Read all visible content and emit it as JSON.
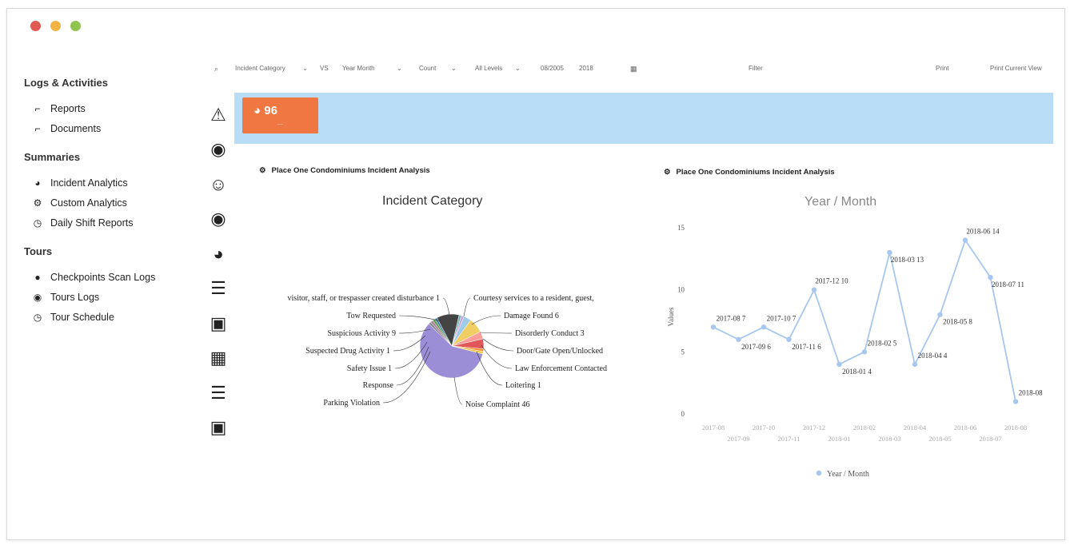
{
  "window": {
    "traffic_colors": [
      "#e05a52",
      "#f2b544",
      "#8fc44f"
    ]
  },
  "sidebar": {
    "sections": [
      {
        "title": "Logs & Activities",
        "items": [
          {
            "label": "Reports",
            "icon": "file-icon"
          },
          {
            "label": "Documents",
            "icon": "file-icon"
          }
        ]
      },
      {
        "title": "Summaries",
        "items": [
          {
            "label": "Incident Analytics",
            "icon": "pie-icon"
          },
          {
            "label": "Custom Analytics",
            "icon": "cogs-icon"
          },
          {
            "label": "Daily Shift Reports",
            "icon": "clock-icon"
          }
        ]
      },
      {
        "title": "Tours",
        "items": [
          {
            "label": "Checkpoints Scan Logs",
            "icon": "circle-icon"
          },
          {
            "label": "Tours Logs",
            "icon": "globe-icon"
          },
          {
            "label": "Tour Schedule",
            "icon": "clock-icon"
          }
        ]
      }
    ]
  },
  "toolbar": {
    "row_field": "Incident Category",
    "vs": "VS",
    "col_field": "Year Month",
    "aggregate": "Count",
    "levels": "All Levels",
    "date_from": "08/2005",
    "date_to": "2018",
    "filter": "Filter",
    "print": "Print",
    "print_view": "Print Current View"
  },
  "banner": {
    "kpi_value": "96"
  },
  "panels": {
    "left": {
      "header": "Place One Condominiums Incident Analysis",
      "chart_title": "Incident Category"
    },
    "right": {
      "header": "Place One Condominiums Incident Analysis",
      "chart_title": "Year / Month"
    }
  },
  "chart_data": [
    {
      "type": "pie",
      "title": "Incident Category",
      "slices": [
        {
          "label": "Noise Complaint",
          "value": 46,
          "color": "#9b8ed6"
        },
        {
          "label": "Parking Violation",
          "value": 1,
          "color": "#8a8a8a"
        },
        {
          "label": "Response",
          "value": 1,
          "color": "#b07aa1"
        },
        {
          "label": "Safety Issue",
          "value": 1,
          "color": "#59a14f"
        },
        {
          "label": "Suspected Drug Activity",
          "value": 1,
          "color": "#4e79a7"
        },
        {
          "label": "Suspicious Activity",
          "value": 9,
          "color": "#444444"
        },
        {
          "label": "Tow Requested",
          "value": 1,
          "color": "#76b7b2"
        },
        {
          "label": "visitor, staff, or trespasser created disturbance",
          "value": 1,
          "color": "#c9a0dc"
        },
        {
          "label": "Courtesy services to a resident, guest,",
          "value": 3,
          "color": "#a0cbe8"
        },
        {
          "label": "Damage Found",
          "value": 6,
          "color": "#f1ce63"
        },
        {
          "label": "Disorderly Conduct",
          "value": 3,
          "color": "#ff9d9a"
        },
        {
          "label": "Door/Gate Open/Unlocked",
          "value": 4,
          "color": "#e15759"
        },
        {
          "label": "Law Enforcement Contacted",
          "value": 1,
          "color": "#f28e2b"
        },
        {
          "label": "Loitering",
          "value": 1,
          "color": "#edc948"
        }
      ],
      "display_labels": [
        "visitor, staff, or trespasser created disturbance  1",
        "Tow Requested",
        "Suspicious Activity  9",
        "Suspected Drug Activity  1",
        "Safety Issue  1",
        "Response",
        "Parking Violation",
        "Courtesy services to a resident, guest,",
        "Damage Found  6",
        "Disorderly Conduct  3",
        "Door/Gate Open/Unlocked",
        "Law Enforcement Contacted",
        "Loitering  1",
        "Noise Complaint  46"
      ]
    },
    {
      "type": "line",
      "title": "Year / Month",
      "ylabel": "Values",
      "ylim": [
        0,
        15
      ],
      "yticks": [
        "0",
        "5",
        "10",
        "15"
      ],
      "legend": "Year / Month",
      "legend_position": "bottom-center",
      "color": "#a7c7ef",
      "x": [
        "2017-08",
        "2017-09",
        "2017-10",
        "2017-11",
        "2017-12",
        "2018-01",
        "2018-02",
        "2018-03",
        "2018-04",
        "2018-05",
        "2018-06",
        "2018-07",
        "2018-08"
      ],
      "values": [
        7,
        6,
        7,
        6,
        10,
        4,
        5,
        13,
        4,
        8,
        14,
        11,
        1
      ],
      "point_labels": [
        "2017-08",
        "2017-09",
        "2017-10",
        "2017-11",
        "2017-12",
        "2018-01",
        "2018-02",
        "2018-03",
        "2018-04",
        "2018-05",
        "2018-06",
        "2018-07",
        "2018-08"
      ],
      "tick_row1": [
        "2017-08",
        "2017-10",
        "2017-12",
        "2018-02",
        "2018-04",
        "2018-06",
        "2018-08"
      ],
      "tick_row2": [
        "2017-09",
        "2017-11",
        "2018-01",
        "2018-03",
        "2018-05",
        "2018-07"
      ]
    }
  ]
}
